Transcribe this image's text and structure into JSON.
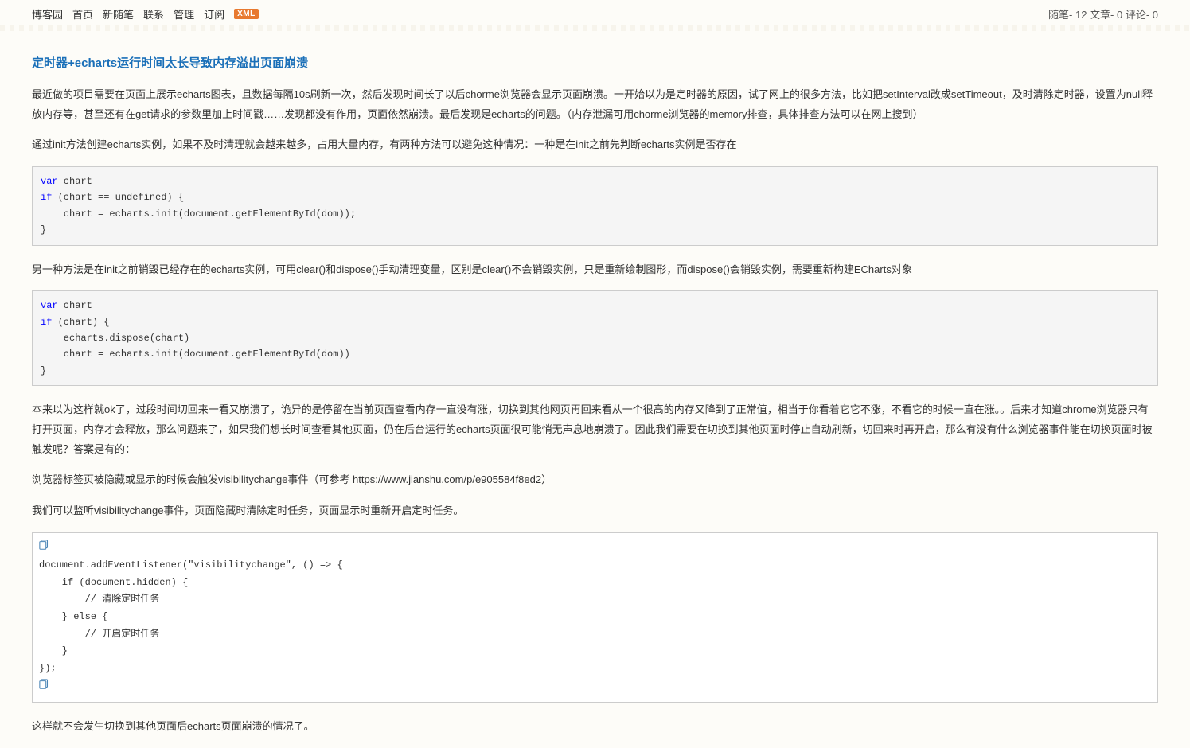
{
  "nav": {
    "site": "博客园",
    "home": "首页",
    "newpost": "新随笔",
    "contact": "联系",
    "manage": "管理",
    "subscribe": "订阅",
    "xml": "XML"
  },
  "stats": {
    "text": "随笔- 12  文章- 0  评论- 0"
  },
  "post": {
    "title": "定时器+echarts运行时间太长导致内存溢出页面崩溃",
    "p1": "最近做的项目需要在页面上展示echarts图表，且数据每隔10s刷新一次，然后发现时间长了以后chorme浏览器会显示页面崩溃。一开始以为是定时器的原因，试了网上的很多方法，比如把setInterval改成setTimeout，及时清除定时器，设置为null释放内存等，甚至还有在get请求的参数里加上时间戳……发现都没有作用，页面依然崩溃。最后发现是echarts的问题。（内存泄漏可用chorme浏览器的memory排查，具体排查方法可以在网上搜到）",
    "p2": "通过init方法创建echarts实例，如果不及时清理就会越来越多，占用大量内存，有两种方法可以避免这种情况：一种是在init之前先判断echarts实例是否存在",
    "code1": {
      "l1a": "var",
      "l1b": " chart",
      "l2a": "if",
      "l2b": " (chart == undefined) {",
      "l3": "    chart = echarts.init(document.getElementById(dom));",
      "l4": "}"
    },
    "p3": "另一种方法是在init之前销毁已经存在的echarts实例，可用clear()和dispose()手动清理变量，区别是clear()不会销毁实例，只是重新绘制图形，而dispose()会销毁实例，需要重新构建ECharts对象",
    "code2": {
      "l1a": "var",
      "l1b": " chart",
      "l2a": "if",
      "l2b": " (chart) {",
      "l3": "    echarts.dispose(chart)",
      "l4": "    chart = echarts.init(document.getElementById(dom))",
      "l5": "}"
    },
    "p4": "本来以为这样就ok了，过段时间切回来一看又崩溃了，诡异的是停留在当前页面查看内存一直没有涨，切换到其他网页再回来看从一个很高的内存又降到了正常值，相当于你看着它它不涨，不看它的时候一直在涨。。后来才知道chrome浏览器只有打开页面，内存才会释放，那么问题来了，如果我们想长时间查看其他页面，仍在后台运行的echarts页面很可能悄无声息地崩溃了。因此我们需要在切换到其他页面时停止自动刷新，切回来时再开启，那么有没有什么浏览器事件能在切换页面时被触发呢？答案是有的：",
    "p5": "浏览器标签页被隐藏或显示的时候会触发visibilitychange事件（可参考 https://www.jianshu.com/p/e905584f8ed2）",
    "p6": "我们可以监听visibilitychange事件，页面隐藏时清除定时任务，页面显示时重新开启定时任务。",
    "code3": {
      "l1": "document.addEventListener(\"visibilitychange\", () => {",
      "l2a": "    if",
      "l2b": " (document.hidden) {",
      "l3a": "        // ",
      "l3b": "清除定时任务",
      "l4a": "    } ",
      "l4b": "else",
      "l4c": " {",
      "l5a": "        // ",
      "l5b": "开启定时任务",
      "l6": "    }",
      "l7": "});"
    },
    "p7": "这样就不会发生切换到其他页面后echarts页面崩溃的情况了。"
  }
}
